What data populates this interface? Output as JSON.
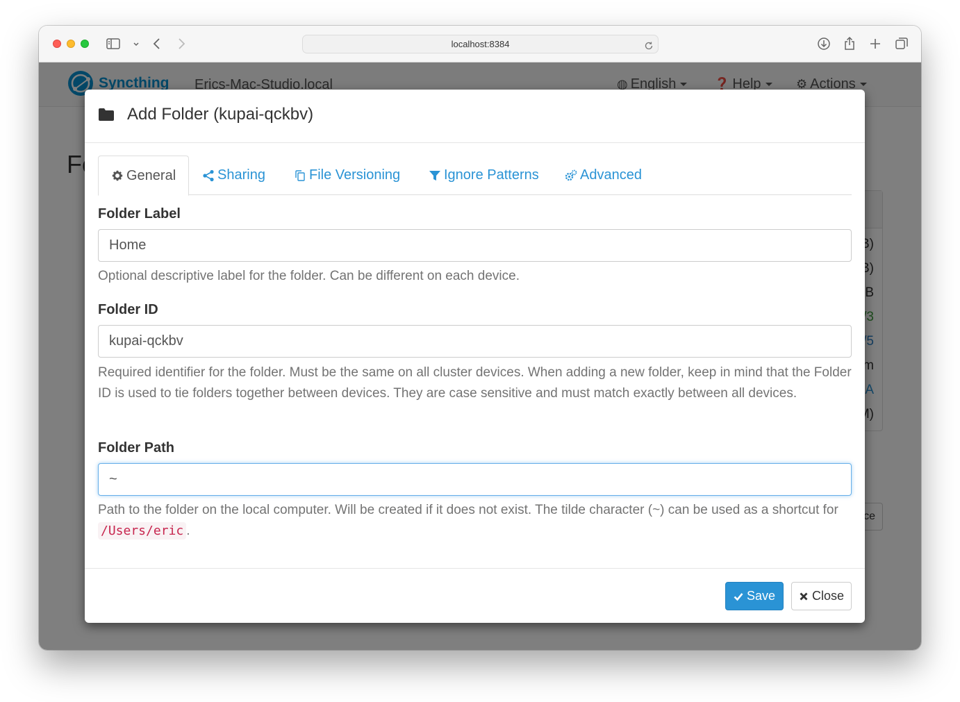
{
  "browser": {
    "url": "localhost:8384"
  },
  "navbar": {
    "brand": "Syncthing",
    "hostname": "Erics-Mac-Studio.local",
    "menus": [
      "English",
      "Help",
      "Actions"
    ]
  },
  "background": {
    "heading": "Fo",
    "fragments": [
      "B)",
      "B)",
      "B",
      "/3",
      "/5",
      "m",
      "A",
      "M)"
    ],
    "fragment_colors": [
      "#333333",
      "#333333",
      "#333333",
      "#3c9a3c",
      "#2a7fc5",
      "#333333",
      "#2a93d5",
      "#333333"
    ],
    "button_fragment": "ce"
  },
  "modal": {
    "title": "Add Folder (kupai-qckbv)",
    "tabs": [
      "General",
      "Sharing",
      "File Versioning",
      "Ignore Patterns",
      "Advanced"
    ],
    "active_tab": "General",
    "folder_label": {
      "label": "Folder Label",
      "value": "Home",
      "help": "Optional descriptive label for the folder. Can be different on each device."
    },
    "folder_id": {
      "label": "Folder ID",
      "value": "kupai-qckbv",
      "help": "Required identifier for the folder. Must be the same on all cluster devices. When adding a new folder, keep in mind that the Folder ID is used to tie folders together between devices. They are case sensitive and must match exactly between all devices."
    },
    "folder_path": {
      "label": "Folder Path",
      "value": "~",
      "help_prefix": "Path to the folder on the local computer. Will be created if it does not exist. The tilde character (~) can be used as a shortcut for",
      "help_code": "/Users/eric",
      "help_suffix": "."
    },
    "buttons": {
      "save": "Save",
      "close": "Close"
    }
  },
  "colors": {
    "accent": "#2a93d5",
    "brand": "#0891d1",
    "code": "#c7254e"
  }
}
